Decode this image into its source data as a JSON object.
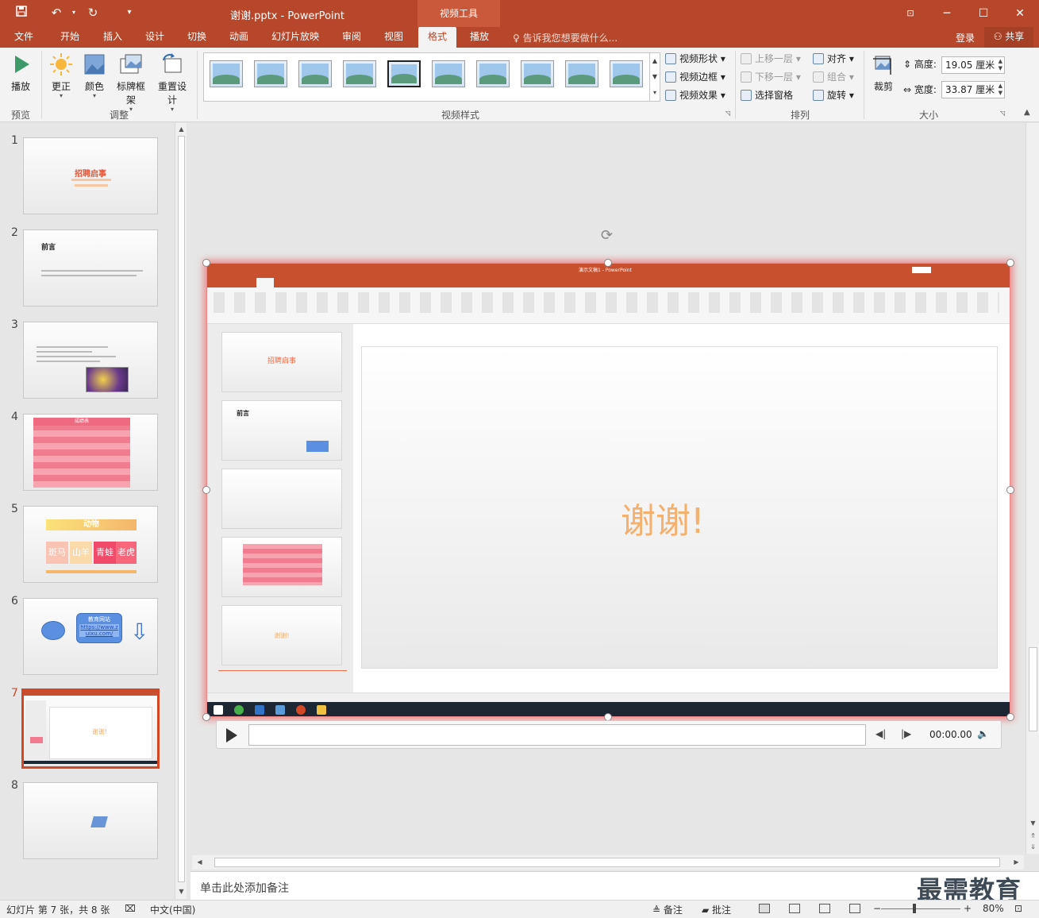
{
  "window": {
    "title": "谢谢.pptx - PowerPoint",
    "context_tools": "视频工具"
  },
  "tabs": [
    {
      "label": "文件"
    },
    {
      "label": "开始"
    },
    {
      "label": "插入"
    },
    {
      "label": "设计"
    },
    {
      "label": "切换"
    },
    {
      "label": "动画"
    },
    {
      "label": "幻灯片放映"
    },
    {
      "label": "审阅"
    },
    {
      "label": "视图"
    },
    {
      "label": "格式"
    },
    {
      "label": "播放"
    }
  ],
  "active_tab": "格式",
  "tellme": "告诉我您想要做什么...",
  "login": "登录",
  "share": "共享",
  "ribbon": {
    "preview": {
      "play": "播放",
      "group": "预览"
    },
    "adjust": {
      "correct": "更正",
      "color": "颜色",
      "poster_frame": "标牌框架",
      "reset_design": "重置设计",
      "group": "调整"
    },
    "video_styles": {
      "group": "视频样式",
      "shape": "视频形状",
      "border": "视频边框",
      "effects": "视频效果"
    },
    "arrange": {
      "bring_forward": "上移一层",
      "send_backward": "下移一层",
      "selection_pane": "选择窗格",
      "align": "对齐",
      "group_btn": "组合",
      "rotate": "旋转",
      "group": "排列"
    },
    "size": {
      "crop": "裁剪",
      "height_label": "高度:",
      "height_value": "19.05 厘米",
      "width_label": "宽度:",
      "width_value": "33.87 厘米",
      "group": "大小"
    }
  },
  "slides": [
    {
      "num": "1",
      "title": "招聘启事"
    },
    {
      "num": "2",
      "title": "前言"
    },
    {
      "num": "3"
    },
    {
      "num": "4",
      "header": "成绩表"
    },
    {
      "num": "5",
      "title": "动物",
      "cells": [
        "斑马",
        "山羊",
        "青蛙",
        "老虎"
      ]
    },
    {
      "num": "6",
      "box_title": "教育网站",
      "link": "https://www.zuixu.com/"
    },
    {
      "num": "7",
      "text": "谢谢!"
    },
    {
      "num": "8"
    }
  ],
  "video": {
    "inner_title": "演示文稿1 - PowerPoint",
    "thanks": "谢谢!",
    "inner_slide_titles": [
      "招聘启事",
      "前言",
      "",
      "",
      "谢谢!"
    ]
  },
  "media": {
    "time": "00:00.00"
  },
  "notes_placeholder": "单击此处添加备注",
  "watermark": "最需教育",
  "status": {
    "slide_info": "幻灯片 第 7 张，共 8 张",
    "language": "中文(中国)",
    "notes": "备注",
    "comments": "批注",
    "zoom": "80%"
  }
}
